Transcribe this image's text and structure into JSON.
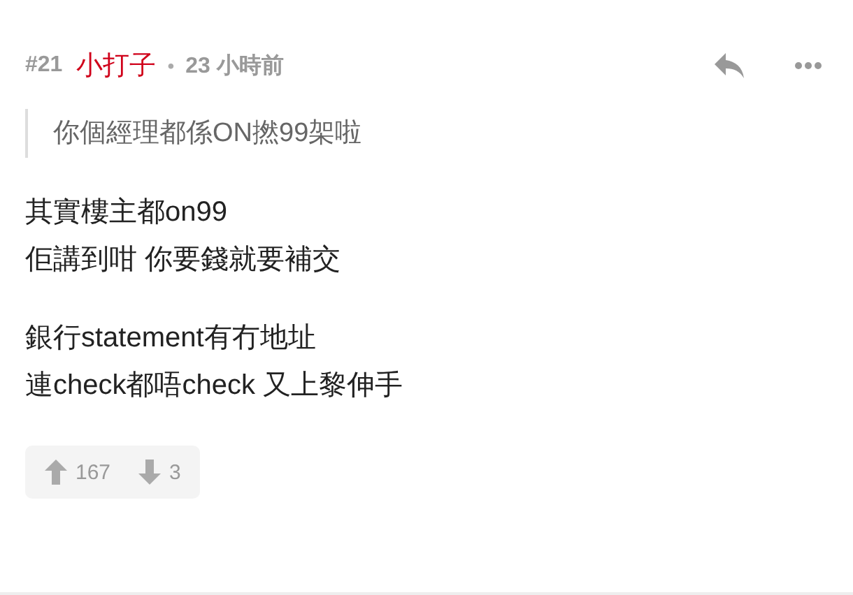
{
  "post": {
    "number": "#21",
    "author": "小打子",
    "separator": "•",
    "time": "23 小時前"
  },
  "quote": "你個經理都係ON撚99架啦",
  "paragraphs": [
    [
      "其實樓主都on99",
      "佢講到咁 你要錢就要補交"
    ],
    [
      "銀行statement有冇地址",
      "連check都唔check 又上黎伸手"
    ]
  ],
  "votes": {
    "up": "167",
    "down": "3"
  }
}
